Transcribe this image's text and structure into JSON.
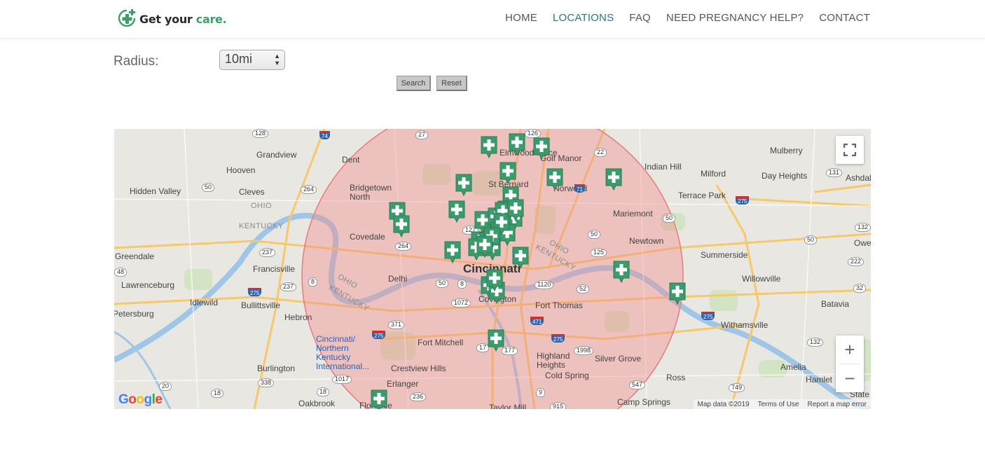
{
  "header": {
    "logo_text": "Get your ",
    "logo_accent": "care.",
    "nav": [
      {
        "label": "HOME"
      },
      {
        "label": "LOCATIONS"
      },
      {
        "label": "FAQ"
      },
      {
        "label": "NEED PREGNANCY HELP?"
      },
      {
        "label": "CONTACT"
      }
    ],
    "active_nav": "LOCATIONS"
  },
  "search": {
    "radius_label": "Radius:",
    "radius_value": "10mi",
    "search_button": "Search",
    "reset_button": "Reset"
  },
  "map": {
    "places": [
      "Grandview",
      "Hooven",
      "Hidden Valley",
      "Cleves",
      "Dent",
      "Bridgetown North",
      "Covedale",
      "Delhi",
      "Cincinnati",
      "Elmwood Place",
      "St Bernard",
      "Golf Manor",
      "Norwood",
      "Indian Hill",
      "Mulberry",
      "Milford",
      "Day Heights",
      "Ashdal",
      "Terrace Park",
      "Mariemont",
      "Newtown",
      "Summerside",
      "Owe",
      "Willowville",
      "Batavia",
      "Withamsville",
      "Amelia",
      "Hamlet",
      "Ross",
      "Silver Grove",
      "Camp Springs",
      "Highland Heights",
      "Cold Spring",
      "Fort Thomas",
      "Fort Mitchell",
      "Crestview Hills",
      "Erlanger",
      "Taylor Mill",
      "Covington",
      "Burlington",
      "Hebron",
      "Oakbrook",
      "Florence",
      "Idlewild",
      "Bullittsville",
      "Francisville",
      "Greendale",
      "Lawrenceburg",
      "Petersburg",
      "Cincinnati/ Northern Kentucky International...",
      "State"
    ],
    "state_labels": [
      "OHIO",
      "KENTUCKY",
      "OHIO",
      "KENTUCKY",
      "OHIO",
      "KENTUCKY"
    ],
    "route_shields": [
      "128",
      "74",
      "27",
      "126",
      "22",
      "50",
      "264",
      "71",
      "131",
      "275",
      "50",
      "132",
      "237",
      "48",
      "275",
      "237",
      "264",
      "127",
      "50",
      "8",
      "50",
      "1120",
      "52",
      "125",
      "222",
      "32",
      "275",
      "8",
      "1072",
      "371",
      "275",
      "17",
      "177",
      "471",
      "275",
      "1998",
      "132",
      "547",
      "749",
      "20",
      "338",
      "18",
      "1017",
      "236",
      "9",
      "18",
      "915",
      "50"
    ],
    "attribution": {
      "google": "Google",
      "data": "Map data ©2019",
      "terms": "Terms of Use",
      "report": "Report a map error"
    },
    "controls": {
      "zoom_in": "+",
      "zoom_out": "−"
    },
    "radius_circle_color": "#f4a7a7",
    "marker_color": "#3a9c6c",
    "marker_count": 35
  }
}
